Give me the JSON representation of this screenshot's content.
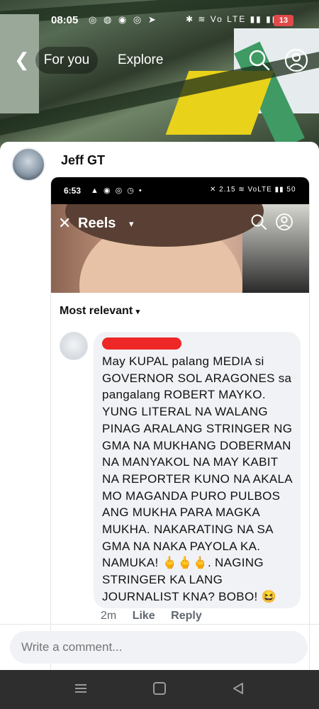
{
  "status_bar": {
    "time": "08:05",
    "app_icons": "◎ ◍ ◉ ◎ ➤",
    "right_icons": "✱ ≋ Vo LTE ▮▮ ▮▮▮",
    "battery": "13"
  },
  "nav": {
    "back_icon": "back-arrow-icon",
    "tab_for_you": "For you",
    "tab_explore": "Explore"
  },
  "post": {
    "author": "Jeff GT"
  },
  "embedded": {
    "status_time": "6:53",
    "status_icons": "▲ ◉ ◎ ◷ •",
    "status_right": "✕ 2.15 ≋ VoLTE ▮▮ 50",
    "reels_label": "Reels",
    "sort_label": "Most relevant",
    "comment_text": "May KUPAL palang MEDIA si GOVERNOR SOL ARAGONES sa pangalang ROBERT MAYKO. YUNG LITERAL NA WALANG PINAG ARALANG STRINGER NG GMA NA MUKHANG DOBERMAN NA MANYAKOL NA MAY KABIT NA REPORTER KUNO NA AKALA MO MAGANDA PURO PULBOS ANG MUKHA PARA MAGKA MUKHA. NAKARATING NA SA GMA NA NAKA PAYOLA KA. NAMUKA! 🖕🖕🖕. NAGING STRINGER KA LANG JOURNALIST KNA? BOBO! 😆",
    "comment_time": "2m",
    "like_label": "Like",
    "reply_label": "Reply"
  },
  "composer": {
    "placeholder": "Write a comment..."
  },
  "colors": {
    "redaction": "#ee2727",
    "battery": "#e04a4a"
  }
}
